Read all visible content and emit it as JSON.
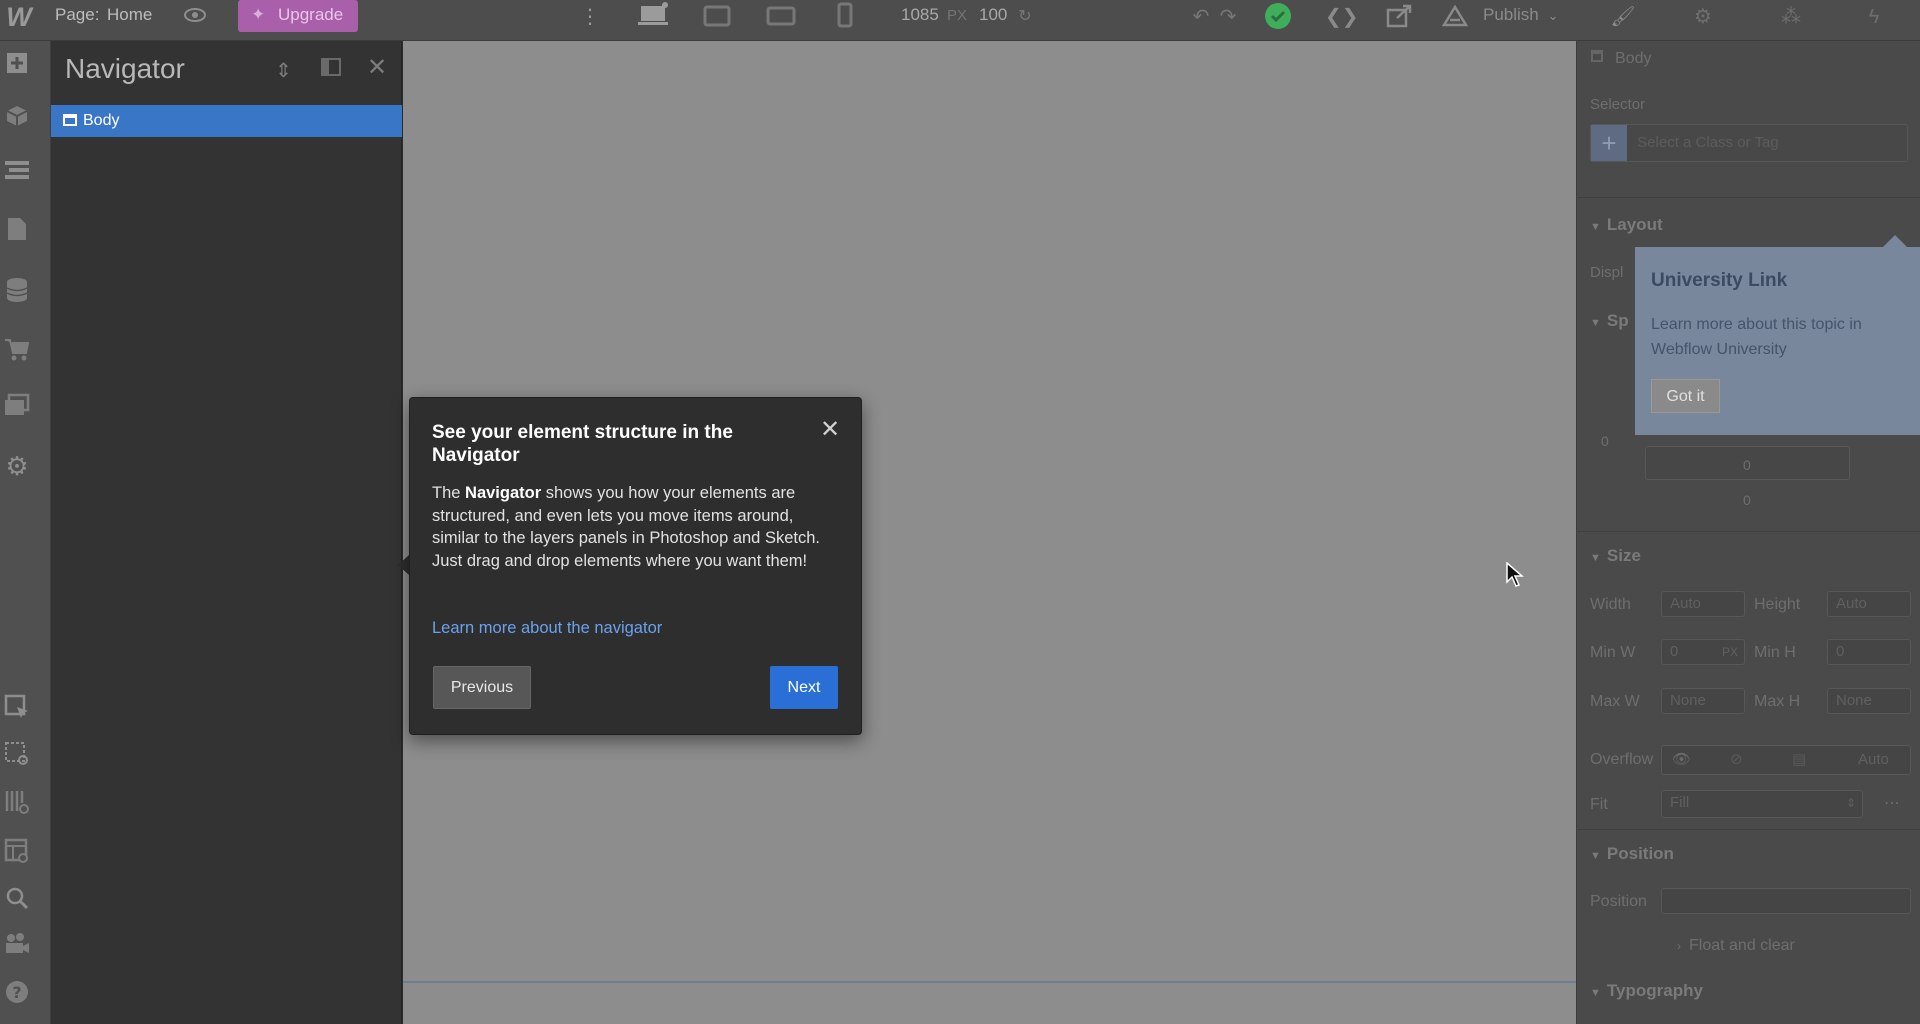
{
  "topbar": {
    "logo": "W",
    "page_prefix": "Page:",
    "page_name": "Home",
    "upgrade_label": "Upgrade",
    "canvas_width": "1085",
    "width_unit": "PX",
    "zoom": "100",
    "publish_label": "Publish"
  },
  "navigator": {
    "title": "Navigator",
    "items": [
      {
        "label": "Body"
      }
    ]
  },
  "right_panel": {
    "element_name": "Body",
    "selector_label": "Selector",
    "selector_placeholder": "Select a Class or Tag",
    "layout_title": "Layout",
    "display_label": "Displ",
    "spacing_label": "Sp",
    "spacing_values": {
      "margin": "0",
      "padding_left": "0",
      "padding_bottom": "0",
      "padding_center": "0"
    },
    "size_title": "Size",
    "width_label": "Width",
    "width_value": "Auto",
    "height_label": "Height",
    "height_value": "Auto",
    "min_w_label": "Min W",
    "min_w_value": "0",
    "min_w_unit": "PX",
    "min_h_label": "Min H",
    "min_h_value": "0",
    "max_w_label": "Max W",
    "max_w_value": "None",
    "max_h_label": "Max H",
    "max_h_value": "None",
    "overflow_label": "Overflow",
    "overflow_auto": "Auto",
    "fit_label": "Fit",
    "fit_value": "Fill",
    "position_title": "Position",
    "position_label": "Position",
    "float_clear_label": "Float and clear",
    "typography_title": "Typography"
  },
  "tooltip": {
    "title": "University Link",
    "body": "Learn more about this topic in Webflow University",
    "button": "Got it"
  },
  "dialog": {
    "title": "See your element structure in the Navigator",
    "body_prefix": "The ",
    "body_bold": "Navigator",
    "body_rest": " shows you how your elements are structured, and even lets you move items around, similar to the layers panels in Photoshop and Sketch. Just drag and drop elements where you want them!",
    "link": "Learn more about the navigator",
    "previous": "Previous",
    "next": "Next",
    "close_icon": "close-icon"
  },
  "colors": {
    "accent_blue": "#2a6fd6",
    "selected_row": "#3a76c6",
    "link": "#6aa2ee",
    "publish_check": "#3fae5a"
  }
}
